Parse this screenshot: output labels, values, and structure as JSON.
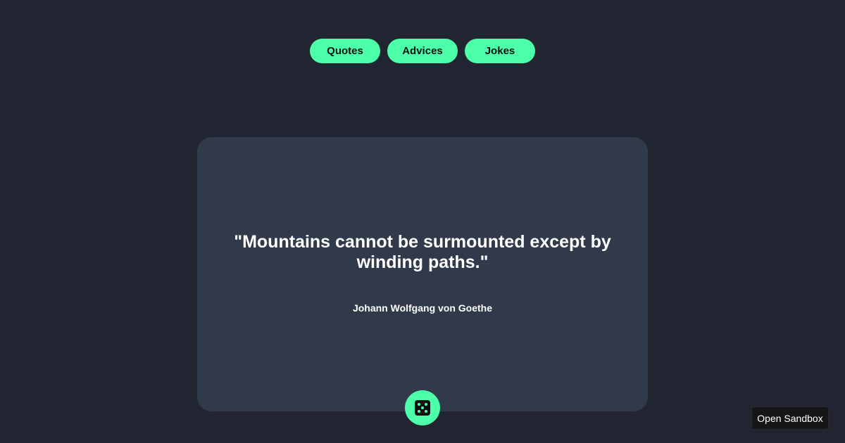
{
  "nav": {
    "items": [
      {
        "label": "Quotes"
      },
      {
        "label": "Advices"
      },
      {
        "label": "Jokes"
      }
    ]
  },
  "card": {
    "quote": "\"Mountains cannot be surmounted except by winding paths.\"",
    "author": "Johann Wolfgang von Goethe"
  },
  "dice_button": {
    "icon": "dice-icon"
  },
  "sandbox": {
    "label": "Open Sandbox"
  },
  "colors": {
    "background": "#202531",
    "card": "#313a4a",
    "accent": "#4dffa8",
    "text": "#ffffff"
  }
}
